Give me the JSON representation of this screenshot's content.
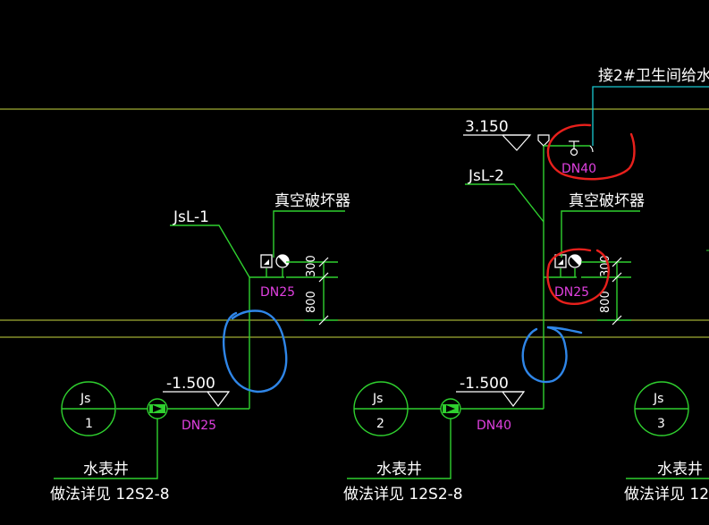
{
  "colors": {
    "background": "#000000",
    "pipe": "#2fd02f",
    "floor_line": "#c8d840",
    "text": "#ffffff",
    "pipe_size": "#e040e0",
    "markup_red": "#e8201c",
    "markup_blue": "#2f86e8",
    "connector": "#18c8d0"
  },
  "labels": {
    "connect_note": "接2#卫生间给水",
    "elev_top": "3.150",
    "riser_1": "JsL-1",
    "riser_2": "JsL-2",
    "vacuum_breaker": "真空破坏器",
    "elev_bottom": "-1.500",
    "meter_well": "水表井",
    "detail_ref": "做法详见  12S2-8",
    "meter_tag": "Js"
  },
  "dims": {
    "d300": "300",
    "d800": "800"
  },
  "pipe_sizes": {
    "dn25": "DN25",
    "dn40": "DN40"
  },
  "meters": [
    {
      "tag": "Js",
      "number": "1"
    },
    {
      "tag": "Js",
      "number": "2"
    },
    {
      "tag": "Js",
      "number": "3"
    }
  ],
  "meter_well_3": "水表井",
  "detail_ref_3": "做法详见  12S"
}
